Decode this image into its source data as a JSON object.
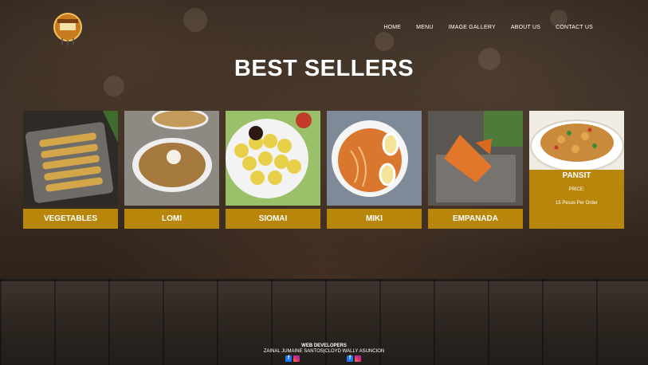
{
  "nav": {
    "items": [
      "HOME",
      "MENU",
      "IMAGE GALLERY",
      "ABOUT US",
      "CONTACT US"
    ]
  },
  "page": {
    "title": "BEST SELLERS"
  },
  "products": [
    {
      "name": "VEGETABLES"
    },
    {
      "name": "LOMI"
    },
    {
      "name": "SIOMAI"
    },
    {
      "name": "MIKI"
    },
    {
      "name": "EMPANADA"
    }
  ],
  "featured": {
    "name": "PANSIT",
    "price_label": "PRICE:",
    "price": "15 Pesos Per Order"
  },
  "footer": {
    "heading": "WEB DEVELOPERS",
    "names": "ZAINAL JUMAINE SANTOS|CLOYD WALLY ASUNCION"
  },
  "colors": {
    "accent": "#b8860b"
  }
}
